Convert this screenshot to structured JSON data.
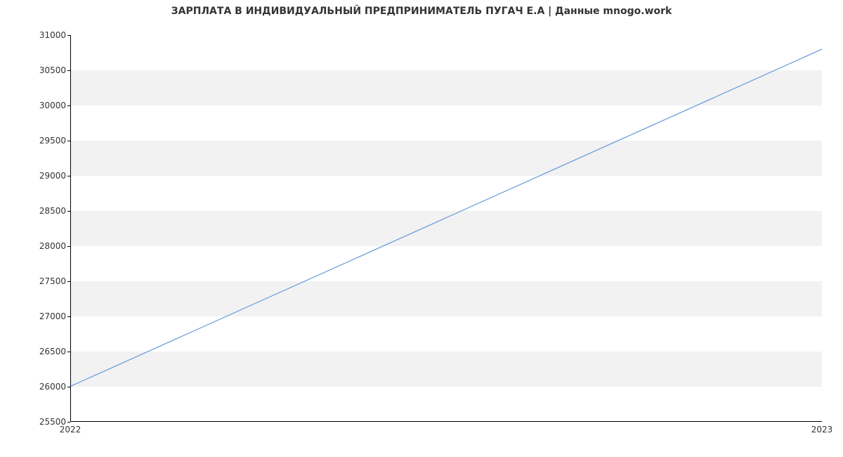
{
  "chart_data": {
    "type": "line",
    "title": "ЗАРПЛАТА В ИНДИВИДУАЛЬНЫЙ ПРЕДПРИНИМАТЕЛЬ ПУГАЧ Е.А | Данные mnogo.work",
    "xlabel": "",
    "ylabel": "",
    "x": [
      "2022",
      "2023"
    ],
    "values": [
      26000,
      30800
    ],
    "y_ticks": [
      25500,
      26000,
      26500,
      27000,
      27500,
      28000,
      28500,
      29000,
      29500,
      30000,
      30500,
      31000
    ],
    "x_ticks": [
      "2022",
      "2023"
    ],
    "ylim": [
      25500,
      31000
    ],
    "line_color": "#6699dd"
  }
}
